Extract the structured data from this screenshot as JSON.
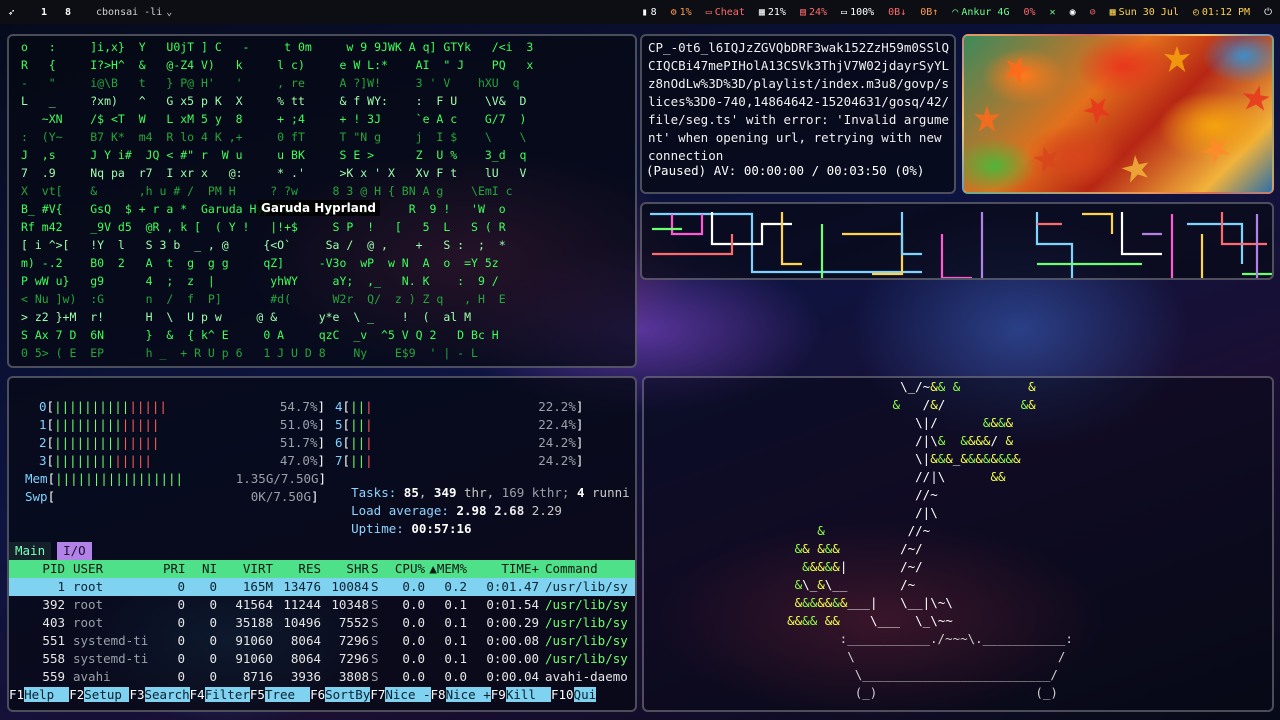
{
  "topbar": {
    "logo_icon": "garuda-logo-icon",
    "workspaces": [
      "1",
      "8"
    ],
    "window_title": "cbonsai -li",
    "widgets": [
      {
        "name": "notes-icon",
        "glyph": "▮",
        "value": "8",
        "color": "#ffffff"
      },
      {
        "name": "gear-icon",
        "glyph": "⚙",
        "value": "1%",
        "color": "#ff9b50"
      },
      {
        "name": "cheat-icon",
        "glyph": "▭",
        "value": "Cheat",
        "color": "#ff6b6b"
      },
      {
        "name": "memory-icon",
        "glyph": "▦",
        "value": "21%",
        "color": "#ffffff"
      },
      {
        "name": "disk-icon",
        "glyph": "▤",
        "value": "24%",
        "color": "#ff6b6b"
      },
      {
        "name": "battery-icon",
        "glyph": "▭",
        "value": "100%",
        "color": "#ffffff"
      },
      {
        "name": "download-icon",
        "glyph": "",
        "value": "0B↓",
        "color": "#ff6b6b"
      },
      {
        "name": "upload-icon",
        "glyph": "",
        "value": "0B↑",
        "color": "#ff9b50"
      },
      {
        "name": "wifi-icon",
        "glyph": "◠",
        "value": "Ankur 4G",
        "color": "#6bff8a"
      },
      {
        "name": "volume-label",
        "glyph": "",
        "value": "0%",
        "color": "#ff6b6b"
      },
      {
        "name": "tools-icon",
        "glyph": "✕",
        "value": "",
        "color": "#6bff8a"
      },
      {
        "name": "globe-icon",
        "glyph": "◉",
        "value": "",
        "color": "#ffffff"
      },
      {
        "name": "eye-off-icon",
        "glyph": "⊘",
        "value": "",
        "color": "#ff6b6b"
      },
      {
        "name": "calendar-icon",
        "glyph": "▦",
        "value": "Sun 30 Jul",
        "color": "#ffd34e"
      },
      {
        "name": "clock-icon",
        "glyph": "◴",
        "value": "01:12 PM",
        "color": "#ffd34e"
      },
      {
        "name": "power-icon",
        "glyph": "⏻",
        "value": "",
        "color": "#ffffff"
      }
    ]
  },
  "matrix": {
    "rows": [
      "o   :     ]i,x}  Y   U0jT ] C   -     t 0m     w 9 9JWK A q] GTYk   /<i  3",
      "R   {     I?>H^  &   @-Z4 V)   k     l c)     e W L:*    AI  \" J    PQ   x",
      "-   \"     i@\\B   t   } P@ H'   '     , re     A ?]W!     3 ' V    hXU  q",
      "L   _     ?xm)   ^   G x5 p K  X     % tt     & f WY:    :  F U    \\V&  D",
      "   ~XN    /$ <T  W   L xM 5 y  8     + ;4     + ! 3J     `e A c    G/7  )",
      ":  (Y~    B7 K*  m4  R lo 4 K ,+     0 fT     T \"N g     j  I $    \\    \\",
      "J  ,s     J Y i#  JQ < #\" r  W u     u BK     S E >      Z  U %    3_d  q",
      "7  .9     Nq pa  r7  I xr x   @:     * .'     >K x ' X   Xv F t    lU   V",
      "X  vt[    &      ,h u # /  PM H     ? ?w     8 3 @ H { BN A g    \\EmI c",
      "B_ #V{    GsQ  $ + r a *  Garuda Hyprland  :t .P Z      R  9 !   'W  o",
      "Rf m42    _9V d5  @R , k [  ( Y !   |!+$     S P  !   [   5  L   S ( R",
      "[ i ^>[   !Y  l   S 3 b  _ , @     {<O`     Sa /  @ ,    +   S :  ;  *",
      "m) -.2    B0  2   A  t  g  g g     qZ]     -V3o  wP  w N  A  o  =Y 5z",
      "P wW u}   g9      4  ;  z  |        yhWY     aY;  ,_   N. K    :  9 /",
      "< Nu ]w)  :G      n  /  f  P]       #d(      W2r  Q/  z ) Z q   , H  E",
      "> z2 }+M  r!      H  \\  U p w     @ &      y*e  \\ _    !  (  al M",
      "S Ax 7 D  6N      }  &  { k^ E     0 A     qzC  _v  ^5 V Q 2   D Bc H",
      "0 5> ( E  EP      h _  + R U p 6   1 J U D 8    Ny    E$9  ' | - L"
    ],
    "highlight": "Garuda Hyprland"
  },
  "mpv": {
    "log_text": "CP_-0t6_l6IQJzZGVQbDRF3wak152ZzH59m0SSlQCIQCBi47mePIHolA13CSVk3ThjV7W02jdayrSyYLz8nOdLw%3D%3D/playlist/index.m3u8/govp/slices%3D0-740,14864642-15204631/gosq/42/file/seg.ts' with error: 'Invalid argument' when opening url, retrying with new connection",
    "status": "(Paused) AV: 00:00:00 / 00:03:50 (0%)"
  },
  "htop": {
    "cpus": [
      {
        "id": "0",
        "pct": "54.7%"
      },
      {
        "id": "1",
        "pct": "51.0%"
      },
      {
        "id": "2",
        "pct": "51.7%"
      },
      {
        "id": "3",
        "pct": "47.0%"
      },
      {
        "id": "4",
        "pct": "22.2%"
      },
      {
        "id": "5",
        "pct": "22.4%"
      },
      {
        "id": "6",
        "pct": "24.2%"
      },
      {
        "id": "7",
        "pct": "24.2%"
      }
    ],
    "mem": {
      "label": "Mem",
      "value": "1.35G/7.50G",
      "bars": "|||||||||||||||||"
    },
    "swp": {
      "label": "Swp",
      "value": "0K/7.50G"
    },
    "tasks_line": {
      "label": "Tasks:",
      "tasks": "85",
      "sep": ",",
      "thr": "349",
      "thr_label": "thr,",
      "kthr": "169",
      "kthr_label": "kthr;",
      "running": "4",
      "running_label": "runni"
    },
    "load_line": {
      "label": "Load average:",
      "l1": "2.98",
      "l5": "2.68",
      "l15": "2.29"
    },
    "uptime_line": {
      "label": "Uptime:",
      "value": "00:57:16"
    },
    "tabs": [
      "Main",
      "I/O"
    ],
    "columns": [
      "PID",
      "USER",
      "PRI",
      "NI",
      "VIRT",
      "RES",
      "SHR",
      "S",
      "CPU%",
      "▲MEM%",
      "TIME+",
      "Command"
    ],
    "processes": [
      {
        "pid": "1",
        "user": "root",
        "pri": "0",
        "ni": "0",
        "virt": "165M",
        "res": "13476",
        "shr": "10084",
        "s": "S",
        "cpu": "0.0",
        "mem": "0.2",
        "time": "0:01.47",
        "cmd": "/usr/lib/sy"
      },
      {
        "pid": "392",
        "user": "root",
        "pri": "0",
        "ni": "0",
        "virt": "41564",
        "res": "11244",
        "shr": "10348",
        "s": "S",
        "cpu": "0.0",
        "mem": "0.1",
        "time": "0:01.54",
        "cmd": "/usr/lib/sy"
      },
      {
        "pid": "403",
        "user": "root",
        "pri": "0",
        "ni": "0",
        "virt": "35188",
        "res": "10496",
        "shr": "7552",
        "s": "S",
        "cpu": "0.0",
        "mem": "0.1",
        "time": "0:00.29",
        "cmd": "/usr/lib/sy"
      },
      {
        "pid": "551",
        "user": "systemd-ti",
        "pri": "0",
        "ni": "0",
        "virt": "91060",
        "res": "8064",
        "shr": "7296",
        "s": "S",
        "cpu": "0.0",
        "mem": "0.1",
        "time": "0:00.08",
        "cmd": "/usr/lib/sy"
      },
      {
        "pid": "558",
        "user": "systemd-ti",
        "pri": "0",
        "ni": "0",
        "virt": "91060",
        "res": "8064",
        "shr": "7296",
        "s": "S",
        "cpu": "0.0",
        "mem": "0.1",
        "time": "0:00.00",
        "cmd": "/usr/lib/sy"
      },
      {
        "pid": "559",
        "user": "avahi",
        "pri": "0",
        "ni": "0",
        "virt": "8716",
        "res": "3936",
        "shr": "3808",
        "s": "S",
        "cpu": "0.0",
        "mem": "0.0",
        "time": "0:00.04",
        "cmd": "avahi-daemo"
      }
    ],
    "fkeys": [
      {
        "key": "F1",
        "label": "Help  "
      },
      {
        "key": "F2",
        "label": "Setup "
      },
      {
        "key": "F3",
        "label": "Search"
      },
      {
        "key": "F4",
        "label": "Filter"
      },
      {
        "key": "F5",
        "label": "Tree  "
      },
      {
        "key": "F6",
        "label": "SortBy"
      },
      {
        "key": "F7",
        "label": "Nice -"
      },
      {
        "key": "F8",
        "label": "Nice +"
      },
      {
        "key": "F9",
        "label": "Kill  "
      },
      {
        "key": "F10",
        "label": "Qui"
      }
    ]
  },
  "bonsai": {
    "lines": [
      "                                  \\_/~&& &         &",
      "                                 &   /&/          &&",
      "                                    \\|/      &&&&",
      "                                    /|\\&  &&&&/ &",
      "                                    \\|&&&_&&&&&&&&",
      "                                    //|\\      &&",
      "                                    //~",
      "                                    /|\\",
      "                       &           //~",
      "                    && &&&        /~/",
      "                     &&&&&|       /~/",
      "                    &\\_&\\__       /~",
      "                    &&&&&&&___|   \\__|\\~\\",
      "                   &&&& &&    \\___  \\_\\~~",
      "                          :___________./~~~\\.___________:",
      "                           \\                           /",
      "                            \\_________________________/",
      "                            (_)                     (_)"
    ]
  }
}
